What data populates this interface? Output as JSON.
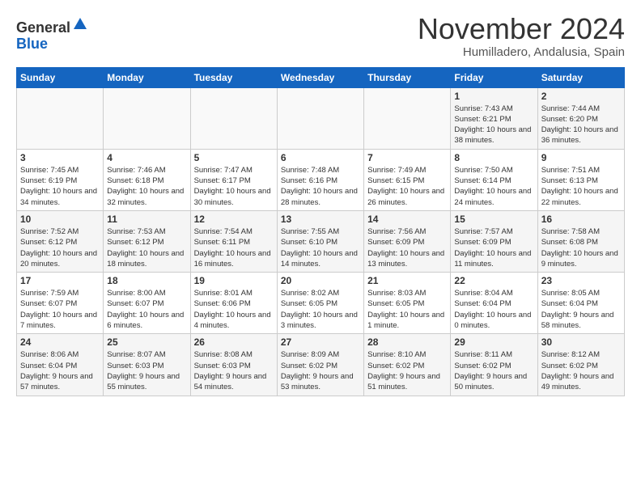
{
  "logo": {
    "general": "General",
    "blue": "Blue"
  },
  "header": {
    "month": "November 2024",
    "location": "Humilladero, Andalusia, Spain"
  },
  "weekdays": [
    "Sunday",
    "Monday",
    "Tuesday",
    "Wednesday",
    "Thursday",
    "Friday",
    "Saturday"
  ],
  "weeks": [
    [
      {
        "day": "",
        "info": ""
      },
      {
        "day": "",
        "info": ""
      },
      {
        "day": "",
        "info": ""
      },
      {
        "day": "",
        "info": ""
      },
      {
        "day": "",
        "info": ""
      },
      {
        "day": "1",
        "info": "Sunrise: 7:43 AM\nSunset: 6:21 PM\nDaylight: 10 hours and 38 minutes."
      },
      {
        "day": "2",
        "info": "Sunrise: 7:44 AM\nSunset: 6:20 PM\nDaylight: 10 hours and 36 minutes."
      }
    ],
    [
      {
        "day": "3",
        "info": "Sunrise: 7:45 AM\nSunset: 6:19 PM\nDaylight: 10 hours and 34 minutes."
      },
      {
        "day": "4",
        "info": "Sunrise: 7:46 AM\nSunset: 6:18 PM\nDaylight: 10 hours and 32 minutes."
      },
      {
        "day": "5",
        "info": "Sunrise: 7:47 AM\nSunset: 6:17 PM\nDaylight: 10 hours and 30 minutes."
      },
      {
        "day": "6",
        "info": "Sunrise: 7:48 AM\nSunset: 6:16 PM\nDaylight: 10 hours and 28 minutes."
      },
      {
        "day": "7",
        "info": "Sunrise: 7:49 AM\nSunset: 6:15 PM\nDaylight: 10 hours and 26 minutes."
      },
      {
        "day": "8",
        "info": "Sunrise: 7:50 AM\nSunset: 6:14 PM\nDaylight: 10 hours and 24 minutes."
      },
      {
        "day": "9",
        "info": "Sunrise: 7:51 AM\nSunset: 6:13 PM\nDaylight: 10 hours and 22 minutes."
      }
    ],
    [
      {
        "day": "10",
        "info": "Sunrise: 7:52 AM\nSunset: 6:12 PM\nDaylight: 10 hours and 20 minutes."
      },
      {
        "day": "11",
        "info": "Sunrise: 7:53 AM\nSunset: 6:12 PM\nDaylight: 10 hours and 18 minutes."
      },
      {
        "day": "12",
        "info": "Sunrise: 7:54 AM\nSunset: 6:11 PM\nDaylight: 10 hours and 16 minutes."
      },
      {
        "day": "13",
        "info": "Sunrise: 7:55 AM\nSunset: 6:10 PM\nDaylight: 10 hours and 14 minutes."
      },
      {
        "day": "14",
        "info": "Sunrise: 7:56 AM\nSunset: 6:09 PM\nDaylight: 10 hours and 13 minutes."
      },
      {
        "day": "15",
        "info": "Sunrise: 7:57 AM\nSunset: 6:09 PM\nDaylight: 10 hours and 11 minutes."
      },
      {
        "day": "16",
        "info": "Sunrise: 7:58 AM\nSunset: 6:08 PM\nDaylight: 10 hours and 9 minutes."
      }
    ],
    [
      {
        "day": "17",
        "info": "Sunrise: 7:59 AM\nSunset: 6:07 PM\nDaylight: 10 hours and 7 minutes."
      },
      {
        "day": "18",
        "info": "Sunrise: 8:00 AM\nSunset: 6:07 PM\nDaylight: 10 hours and 6 minutes."
      },
      {
        "day": "19",
        "info": "Sunrise: 8:01 AM\nSunset: 6:06 PM\nDaylight: 10 hours and 4 minutes."
      },
      {
        "day": "20",
        "info": "Sunrise: 8:02 AM\nSunset: 6:05 PM\nDaylight: 10 hours and 3 minutes."
      },
      {
        "day": "21",
        "info": "Sunrise: 8:03 AM\nSunset: 6:05 PM\nDaylight: 10 hours and 1 minute."
      },
      {
        "day": "22",
        "info": "Sunrise: 8:04 AM\nSunset: 6:04 PM\nDaylight: 10 hours and 0 minutes."
      },
      {
        "day": "23",
        "info": "Sunrise: 8:05 AM\nSunset: 6:04 PM\nDaylight: 9 hours and 58 minutes."
      }
    ],
    [
      {
        "day": "24",
        "info": "Sunrise: 8:06 AM\nSunset: 6:04 PM\nDaylight: 9 hours and 57 minutes."
      },
      {
        "day": "25",
        "info": "Sunrise: 8:07 AM\nSunset: 6:03 PM\nDaylight: 9 hours and 55 minutes."
      },
      {
        "day": "26",
        "info": "Sunrise: 8:08 AM\nSunset: 6:03 PM\nDaylight: 9 hours and 54 minutes."
      },
      {
        "day": "27",
        "info": "Sunrise: 8:09 AM\nSunset: 6:02 PM\nDaylight: 9 hours and 53 minutes."
      },
      {
        "day": "28",
        "info": "Sunrise: 8:10 AM\nSunset: 6:02 PM\nDaylight: 9 hours and 51 minutes."
      },
      {
        "day": "29",
        "info": "Sunrise: 8:11 AM\nSunset: 6:02 PM\nDaylight: 9 hours and 50 minutes."
      },
      {
        "day": "30",
        "info": "Sunrise: 8:12 AM\nSunset: 6:02 PM\nDaylight: 9 hours and 49 minutes."
      }
    ]
  ]
}
